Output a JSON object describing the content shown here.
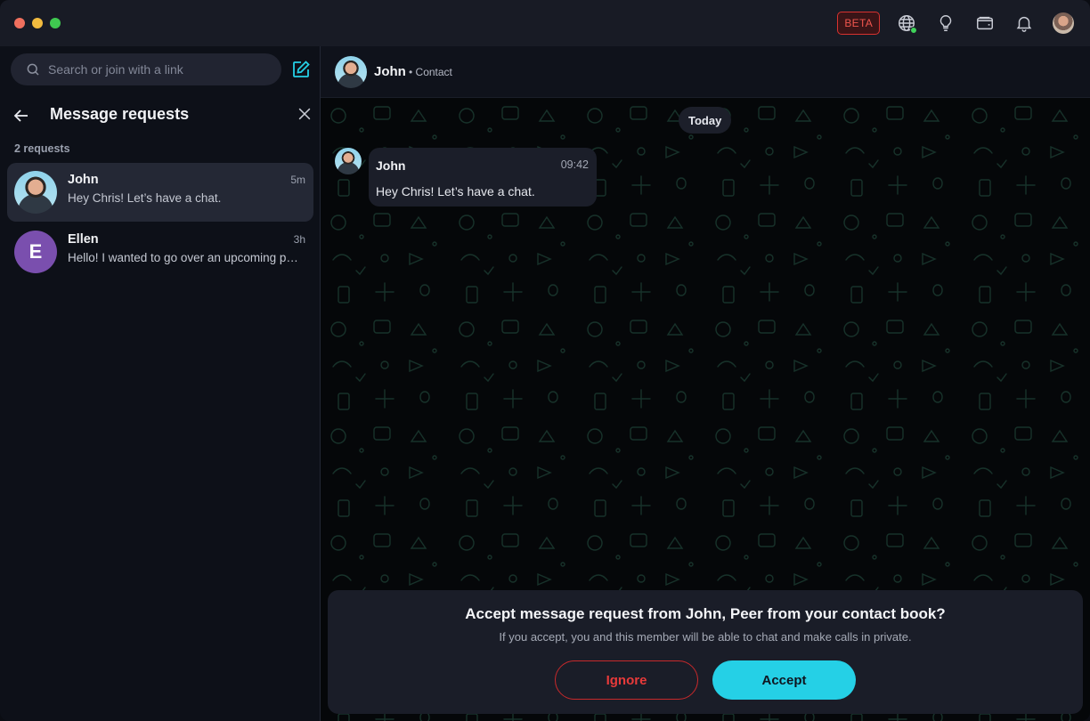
{
  "window": {
    "beta_label": "BETA"
  },
  "search": {
    "placeholder": "Search or join with a link"
  },
  "requests": {
    "title": "Message requests",
    "count_label": "2 requests",
    "items": [
      {
        "name": "John",
        "preview": "Hey Chris! Let’s have a chat.",
        "time": "5m",
        "avatar": "photo"
      },
      {
        "name": "Ellen",
        "preview": "Hello! I wanted to go over an upcoming project with you",
        "time": "3h",
        "avatar_letter": "E"
      }
    ]
  },
  "chat": {
    "contact_name": "John",
    "contact_sub": "• Contact",
    "date_label": "Today",
    "message": {
      "sender": "John",
      "time": "09:42",
      "text": "Hey Chris! Let’s have a chat."
    }
  },
  "request_panel": {
    "title": "Accept message request from John, Peer from your contact book?",
    "subtitle": "If you accept, you and this member will be able to chat and make calls in private.",
    "ignore_label": "Ignore",
    "accept_label": "Accept"
  },
  "icons": {
    "globe": "globe-icon",
    "lightbulb": "lightbulb-icon",
    "wallet": "wallet-icon",
    "bell": "bell-icon",
    "search": "search-icon",
    "compose": "compose-icon",
    "back": "arrow-left-icon",
    "close": "close-icon"
  },
  "colors": {
    "accent": "#25d0e6",
    "danger": "#e83a3a",
    "beta": "#f0564e",
    "online": "#3fd25a"
  }
}
